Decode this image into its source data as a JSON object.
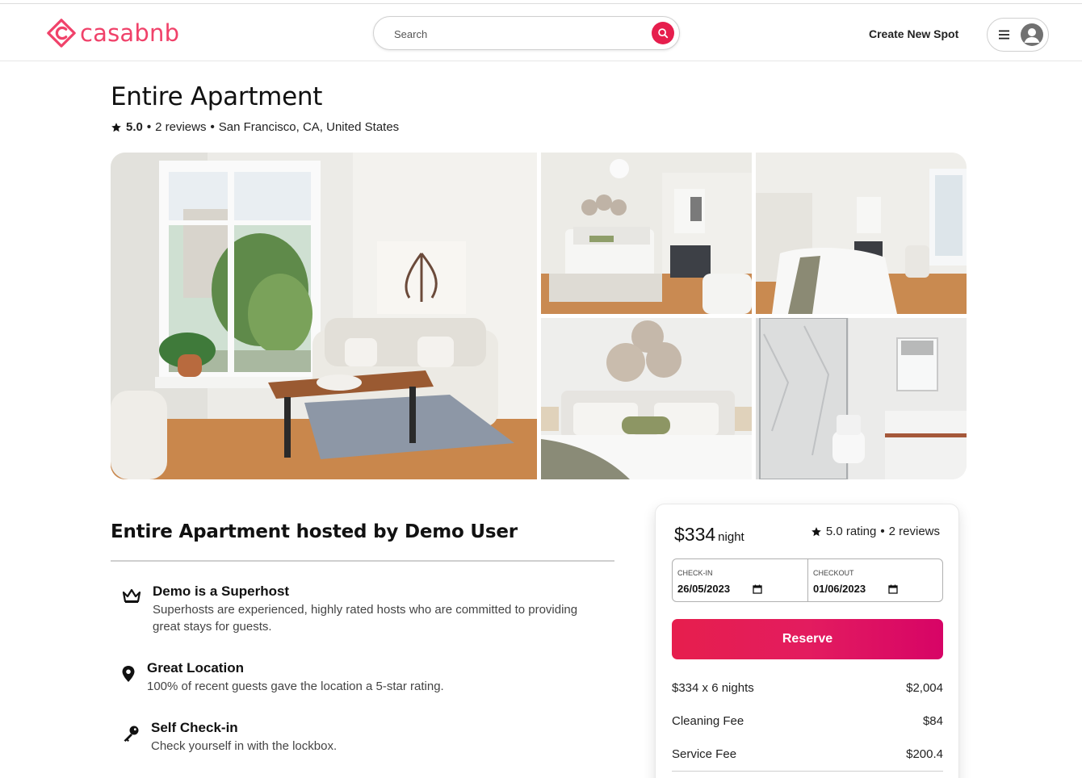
{
  "brand": {
    "name": "casabnb",
    "color": "#f0426a"
  },
  "search": {
    "placeholder": "Search"
  },
  "nav": {
    "create_spot": "Create New Spot"
  },
  "listing": {
    "title": "Entire Apartment",
    "rating": "5.0",
    "reviews": "2 reviews",
    "separator": "•",
    "location": "San Francisco, CA, United States"
  },
  "gallery": {
    "photos": [
      "living-room",
      "bedroom-wide",
      "bedroom-window",
      "bed-headboard",
      "bathroom"
    ]
  },
  "host": {
    "title": "Entire Apartment hosted by Demo User",
    "features": [
      {
        "icon": "crown-icon",
        "title": "Demo is a Superhost",
        "desc_line1": "Superhosts are experienced, highly rated hosts who are committed to providing",
        "desc_line2": "great stays for guests."
      },
      {
        "icon": "location-pin-icon",
        "title": "Great Location",
        "desc_line1": "100% of recent guests gave the location a 5-star rating."
      },
      {
        "icon": "key-icon",
        "title": "Self Check-in",
        "desc_line1": "Check yourself in with the lockbox."
      }
    ]
  },
  "booking": {
    "price": "$334",
    "per": "night",
    "rating": "5.0 rating",
    "separator": "•",
    "reviews": "2 reviews",
    "checkin_label": "CHECK-IN",
    "checkin_value": "26/05/2023",
    "checkout_label": "CHECKOUT",
    "checkout_value": "01/06/2023",
    "reserve_label": "Reserve",
    "fees": [
      {
        "label": "$334 x 6 nights",
        "amount": "$2,004"
      },
      {
        "label": "Cleaning Fee",
        "amount": "$84"
      },
      {
        "label": "Service Fee",
        "amount": "$200.4"
      }
    ]
  }
}
